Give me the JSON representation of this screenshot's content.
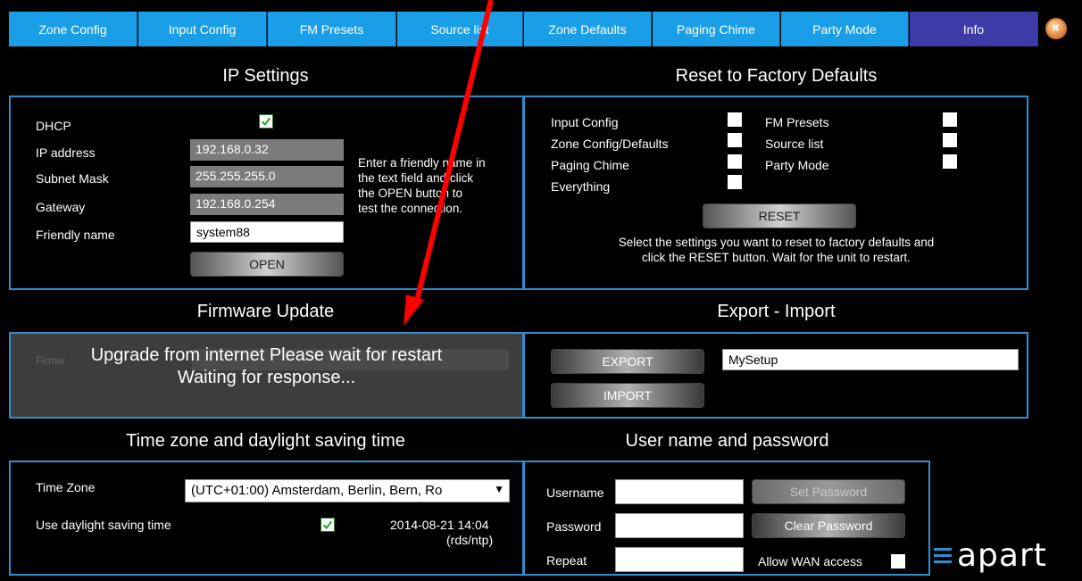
{
  "tabs": [
    "Zone Config",
    "Input Config",
    "FM Presets",
    "Source list",
    "Zone Defaults",
    "Paging Chime",
    "Party Mode",
    "Info"
  ],
  "ip_settings": {
    "title": "IP Settings",
    "dhcp_label": "DHCP",
    "dhcp_checked": true,
    "ip_label": "IP address",
    "ip_value": "192.168.0.32",
    "subnet_label": "Subnet Mask",
    "subnet_value": "255.255.255.0",
    "gateway_label": "Gateway",
    "gateway_value": "192.168.0.254",
    "friendly_label": "Friendly name",
    "friendly_value": "system88",
    "open_button": "OPEN",
    "help_lines": [
      "Enter a friendly name in",
      "the text field and click",
      "the OPEN button to",
      "test the connection."
    ]
  },
  "reset": {
    "title": "Reset to Factory Defaults",
    "input_config": "Input Config",
    "zone_config": "Zone Config/Defaults",
    "paging_chime": "Paging Chime",
    "everything": "Everything",
    "fm_presets": "FM Presets",
    "source_list": "Source list",
    "party_mode": "Party Mode",
    "reset_button": "RESET",
    "help_line1": "Select the settings you want to reset to factory defaults and",
    "help_line2": "click the RESET button. Wait for the unit to restart."
  },
  "firmware": {
    "title": "Firmware Update",
    "hidden_label": "Firmw",
    "overlay_line1": "Upgrade from internet Please wait for restart",
    "overlay_line2": "Waiting for response..."
  },
  "export_import": {
    "title": "Export - Import",
    "export_button": "EXPORT",
    "import_button": "IMPORT",
    "filename": "MySetup"
  },
  "timezone": {
    "title": "Time zone and daylight saving time",
    "tz_label": "Time Zone",
    "tz_value": "(UTC+01:00) Amsterdam, Berlin, Bern, Ro",
    "dst_label": "Use daylight saving time",
    "dst_checked": true,
    "datetime": "2014-08-21 14:04",
    "time_source": "(rds/ntp)"
  },
  "user": {
    "title": "User name and password",
    "username_label": "Username",
    "password_label": "Password",
    "repeat_label": "Repeat",
    "set_password_button": "Set Password",
    "clear_password_button": "Clear Password",
    "wan_label": "Allow WAN access",
    "wan_checked": false
  },
  "logo": "apart",
  "colors": {
    "tab": "#1b9ee8",
    "tab_active": "#3c3ba8",
    "panel_border": "#2e8fd0",
    "annotation_arrow": "#ff0000"
  }
}
